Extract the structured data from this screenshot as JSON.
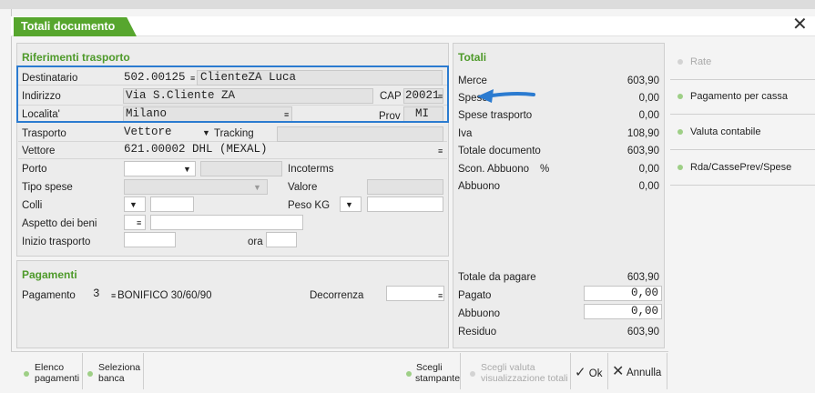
{
  "dialog": {
    "title": "Totali documento"
  },
  "trasporto": {
    "section_title": "Riferimenti trasporto",
    "destinatario_label": "Destinatario",
    "destinatario_code": "502.00125",
    "destinatario_name": "ClienteZA Luca",
    "indirizzo_label": "Indirizzo",
    "indirizzo_value": "Via S.Cliente ZA",
    "cap_label": "CAP",
    "cap_value": "20021",
    "localita_label": "Localita'",
    "localita_value": "Milano",
    "prov_label": "Prov",
    "prov_value": "MI",
    "trasporto_label": "Trasporto",
    "trasporto_value": "Vettore",
    "tracking_label": "Tracking",
    "vettore_label": "Vettore",
    "vettore_value": "621.00002 DHL (MEXAL)",
    "porto_label": "Porto",
    "incoterms_label": "Incoterms",
    "tipo_spese_label": "Tipo spese",
    "valore_label": "Valore",
    "colli_label": "Colli",
    "peso_label": "Peso KG",
    "aspetto_label": "Aspetto dei beni",
    "inizio_label": "Inizio trasporto",
    "ora_label": "ora"
  },
  "pagamenti": {
    "section_title": "Pagamenti",
    "pagamento_label": "Pagamento",
    "pagamento_code": "3",
    "pagamento_desc": "BONIFICO 30/60/90",
    "decorrenza_label": "Decorrenza"
  },
  "totali": {
    "section_title": "Totali",
    "rows": [
      {
        "label": "Merce",
        "value": "603,90"
      },
      {
        "label": "Spese",
        "value": "0,00"
      },
      {
        "label": "Spese trasporto",
        "value": "0,00"
      },
      {
        "label": "Iva",
        "value": "108,90"
      },
      {
        "label": "Totale documento",
        "value": "603,90"
      },
      {
        "label": "Scon. Abbuono",
        "value": "0,00"
      },
      {
        "label": "Abbuono",
        "value": "0,00"
      }
    ],
    "percent_sign": "%",
    "pay_rows": [
      {
        "label": "Totale da pagare",
        "value": "603,90"
      },
      {
        "label": "Pagato",
        "value": "0,00"
      },
      {
        "label": "Abbuono",
        "value": "0,00"
      },
      {
        "label": "Residuo",
        "value": "603,90"
      }
    ]
  },
  "side_menu": [
    {
      "label": "Rate"
    },
    {
      "label": "Pagamento per cassa"
    },
    {
      "label": "Valuta contabile"
    },
    {
      "label": "Rda/CassePrev/Spese"
    }
  ],
  "toolbar": {
    "elenco_line1": "Elenco",
    "elenco_line2": "pagamenti",
    "seleziona_line1": "Seleziona",
    "seleziona_line2": "banca",
    "scegli_line1": "Scegli",
    "scegli_line2": "stampante",
    "valuta_line1": "Scegli valuta",
    "valuta_line2": "visualizzazione totali",
    "ok_label": "Ok",
    "annulla_label": "Annulla"
  },
  "colors": {
    "accent_green": "#57a62e",
    "highlight_blue": "#2b7bd0"
  }
}
